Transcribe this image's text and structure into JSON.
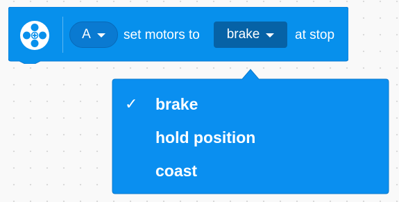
{
  "block": {
    "icon": "motor-icon",
    "port": {
      "value": "A",
      "icon": "caret-down-icon"
    },
    "text_before": "set motors to",
    "mode": {
      "value": "brake",
      "icon": "caret-down-icon"
    },
    "text_after": "at stop",
    "color": "#0790ec"
  },
  "menu": {
    "color": "#0a8ff0",
    "check_mark": "✓",
    "items": [
      {
        "label": "brake",
        "selected": true
      },
      {
        "label": "hold position",
        "selected": false
      },
      {
        "label": "coast",
        "selected": false
      }
    ]
  }
}
